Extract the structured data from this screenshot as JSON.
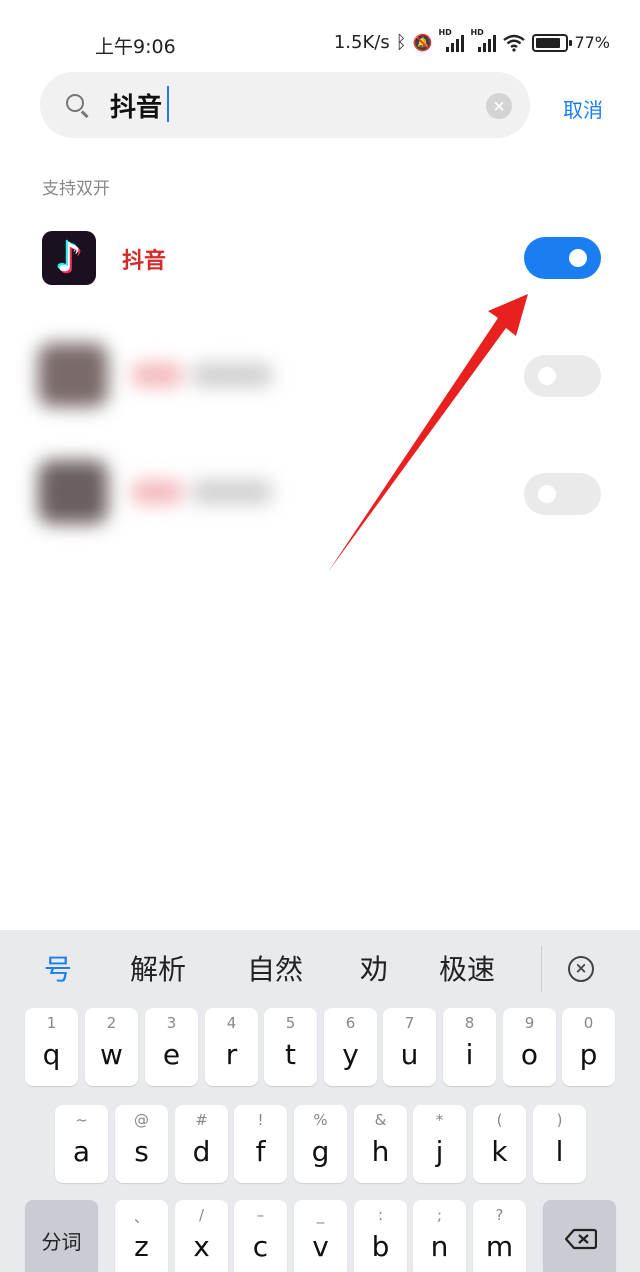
{
  "status_bar": {
    "time": "上午9:06",
    "net_speed": "1.5K/s",
    "sig1_hd": "HD",
    "sig2_hd": "HD",
    "battery_percent": "77%",
    "battery_level": 0.77
  },
  "search": {
    "value": "抖音",
    "cancel_label": "取消",
    "clear_glyph": "×"
  },
  "section": {
    "label": "支持双开"
  },
  "apps": [
    {
      "name": "抖音",
      "icon_glyph": "♪",
      "dual_enabled": true
    },
    {
      "name": "",
      "dual_enabled": false
    },
    {
      "name": "",
      "dual_enabled": false
    }
  ],
  "keyboard": {
    "suggestions": [
      "号",
      "解析",
      "自然",
      "劝",
      "极速"
    ],
    "collapse_glyph": "×",
    "row1": [
      {
        "sub": "1",
        "main": "q"
      },
      {
        "sub": "2",
        "main": "w"
      },
      {
        "sub": "3",
        "main": "e"
      },
      {
        "sub": "4",
        "main": "r"
      },
      {
        "sub": "5",
        "main": "t"
      },
      {
        "sub": "6",
        "main": "y"
      },
      {
        "sub": "7",
        "main": "u"
      },
      {
        "sub": "8",
        "main": "i"
      },
      {
        "sub": "9",
        "main": "o"
      },
      {
        "sub": "0",
        "main": "p"
      }
    ],
    "row2": [
      {
        "sub": "~",
        "main": "a"
      },
      {
        "sub": "@",
        "main": "s"
      },
      {
        "sub": "#",
        "main": "d"
      },
      {
        "sub": "!",
        "main": "f"
      },
      {
        "sub": "%",
        "main": "g"
      },
      {
        "sub": "&",
        "main": "h"
      },
      {
        "sub": "*",
        "main": "j"
      },
      {
        "sub": "(",
        "main": "k"
      },
      {
        "sub": ")",
        "main": "l"
      }
    ],
    "row3": [
      {
        "sub": "、",
        "main": "z"
      },
      {
        "sub": "/",
        "main": "x"
      },
      {
        "sub": "–",
        "main": "c"
      },
      {
        "sub": "_",
        "main": "v"
      },
      {
        "sub": ":",
        "main": "b"
      },
      {
        "sub": ";",
        "main": "n"
      },
      {
        "sub": "?",
        "main": "m"
      }
    ],
    "fenci_label": "分词"
  },
  "colors": {
    "accent": "#1a7ef0",
    "app_name": "#d42a2a",
    "arrow": "#e82020"
  }
}
